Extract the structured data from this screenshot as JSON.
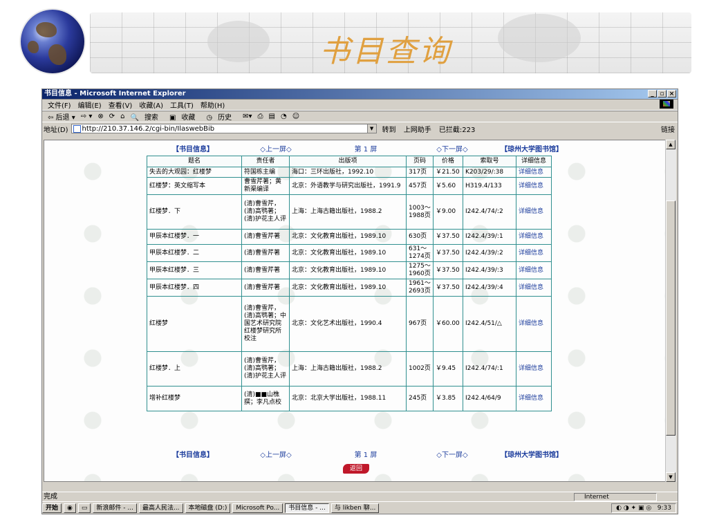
{
  "slide": {
    "title": "书目查询"
  },
  "window": {
    "title": "书目信息 - Microsoft Internet Explorer",
    "controls": [
      "_",
      "▫",
      "×"
    ]
  },
  "menu": [
    "文件(F)",
    "编辑(E)",
    "查看(V)",
    "收藏(A)",
    "工具(T)",
    "帮助(H)"
  ],
  "toolbar": {
    "back": "⇦ 后退 ▾",
    "forward": "⇨ ▾",
    "search": "搜索",
    "favorites": "收藏",
    "history": "历史"
  },
  "address": {
    "label": "地址(D)",
    "url": "http://210.37.146.2/cgi-bin/IlaswebBib",
    "go": "转到",
    "assistant": "上网助手",
    "blocked": "已拦截:223",
    "links": "链接"
  },
  "nav": {
    "home": "【书目信息】",
    "prev": "◇上一屏◇",
    "page": "第 1 屏",
    "next": "◇下一屏◇",
    "library": "【琼州大学图书馆】"
  },
  "table": {
    "headers": [
      "题名",
      "责任者",
      "出版项",
      "页码",
      "价格",
      "索取号",
      "详细信息"
    ],
    "rows": [
      [
        "失去的大观园：红楼梦",
        "符国栋主编",
        "海口：三环出版社，1992.10",
        "317页",
        "￥21.50",
        "K203/29/:38",
        "详细信息"
      ],
      [
        "红楼梦：英文缩写本",
        "曹雪芹著；黄新渠编译",
        "北京：外语教学与研究出版社，1991.9",
        "457页",
        "￥5.60",
        "H319.4/133",
        "详细信息"
      ],
      [
        "红楼梦．下",
        "(清)曹雪芹，(清)高鹗著；(清)护花主人评",
        "上海：上海古籍出版社，1988.2",
        "1003～1988页",
        "￥9.00",
        "I242.4/74/:2",
        "详细信息"
      ],
      [
        "甲辰本红楼梦．一",
        "(清)曹雪芹著",
        "北京：文化教育出版社，1989.10",
        "630页",
        "￥37.50",
        "I242.4/39/:1",
        "详细信息"
      ],
      [
        "甲辰本红楼梦．二",
        "(清)曹雪芹著",
        "北京：文化教育出版社，1989.10",
        "631～1274页",
        "￥37.50",
        "I242.4/39/:2",
        "详细信息"
      ],
      [
        "甲辰本红楼梦．三",
        "(清)曹雪芹著",
        "北京：文化教育出版社，1989.10",
        "1275～1960页",
        "￥37.50",
        "I242.4/39/:3",
        "详细信息"
      ],
      [
        "甲辰本红楼梦．四",
        "(清)曹雪芹著",
        "北京：文化教育出版社，1989.10",
        "1961～2693页",
        "￥37.50",
        "I242.4/39/:4",
        "详细信息"
      ],
      [
        "红楼梦",
        "(清)曹雪芹，(清)高鹗著；中国艺术研究院红楼梦研究所校注",
        "北京：文化艺术出版社，1990.4",
        "967页",
        "￥60.00",
        "I242.4/51/△",
        "详细信息"
      ],
      [
        "红楼梦．上",
        "(清)曹雪芹，(清)高鹗著；(清)护花主人评",
        "上海：上海古籍出版社，1988.2",
        "1002页",
        "￥9.45",
        "I242.4/74/:1",
        "详细信息"
      ],
      [
        "增补红楼梦",
        "(清)■■山樵撰；李凡点校",
        "北京：北京大学出版社，1988.11",
        "245页",
        "￥3.85",
        "I242.4/64/9",
        "详细信息"
      ]
    ]
  },
  "return_button": "返回",
  "status": {
    "text": "完成",
    "zone": "Internet"
  },
  "taskbar": {
    "start": "开始",
    "items": [
      "新浪邮件 - ...",
      "最高人民法...",
      "本地磁盘 (D:)",
      "Microsoft Po...",
      "书目信息 - ...",
      "与 likben 聊..."
    ],
    "clock": "9:33"
  }
}
